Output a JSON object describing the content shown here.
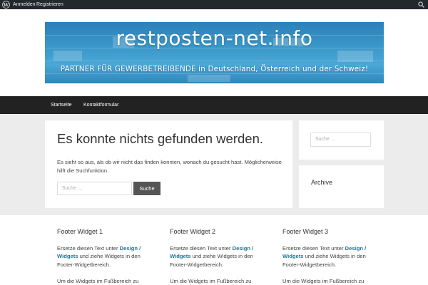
{
  "adminbar": {
    "login": "Anmelden",
    "register": "Registrieren",
    "icons": [
      "wordpress-logo-icon",
      "search-icon"
    ]
  },
  "banner": {
    "title": "restposten-net.info",
    "tagline": "PARTNER FÜR GEWERBETREIBENDE in Deutschland, Österreich und der Schweiz!"
  },
  "nav": {
    "items": [
      {
        "label": "Startseite"
      },
      {
        "label": "Kontaktformular"
      }
    ]
  },
  "main": {
    "heading": "Es konnte nichts gefunden werden.",
    "text": "Es sieht so aus, als ob wir nicht das finden konnten, wonach du gesucht hast. Möglicherweise hilft die Suchfunktion.",
    "search_placeholder": "Suche …",
    "search_button": "Suche"
  },
  "sidebar": {
    "search_placeholder": "Suche …",
    "archive_title": "Archive"
  },
  "footer": {
    "widgets": [
      {
        "title": "Footer Widget 1",
        "text_before": "Ersetze diesen Text unter ",
        "link": "Design / Widgets",
        "text_after": " und ziehe Widgets in den Footer-Widgetbereich.",
        "more": "Um die Widgets im Fußbereich zu"
      },
      {
        "title": "Footer Widget 2",
        "text_before": "Ersetze diesen Text unter ",
        "link": "Design / Widgets",
        "text_after": " und ziehe Widgets in den Footer-Widgetbereich.",
        "more": "Um die Widgets im Fußbereich zu"
      },
      {
        "title": "Footer Widget 3",
        "text_before": "Ersetze diesen Text unter ",
        "link": "Design / Widgets",
        "text_after": " und ziehe Widgets in den Footer-Widgetbereich.",
        "more": "Um die Widgets im Fußbereich zu"
      }
    ]
  },
  "colors": {
    "adminbar": "#23282d",
    "navbar": "#222222",
    "link": "#21759b",
    "content_bg": "#ececec",
    "button": "#555555"
  }
}
